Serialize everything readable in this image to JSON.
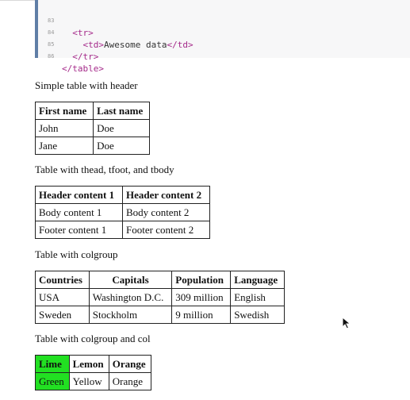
{
  "code": {
    "lines": [
      {
        "num": "83",
        "indent": "  ",
        "open": "<tr>",
        "text": "",
        "close": ""
      },
      {
        "num": "84",
        "indent": "    ",
        "open": "<td>",
        "text": "Awesome data",
        "close": "</td>"
      },
      {
        "num": "85",
        "indent": "  ",
        "open": "</tr>",
        "text": "",
        "close": ""
      },
      {
        "num": "86",
        "indent": "",
        "open": "</table>",
        "text": "",
        "close": ""
      }
    ]
  },
  "sections": {
    "simple": {
      "caption": "Simple table with header",
      "headers": [
        "First name",
        "Last name"
      ],
      "rows": [
        [
          "John",
          "Doe"
        ],
        [
          "Jane",
          "Doe"
        ]
      ]
    },
    "thead": {
      "caption": "Table with thead, tfoot, and tbody",
      "headers": [
        "Header content 1",
        "Header content 2"
      ],
      "rows": [
        [
          "Body content 1",
          "Body content 2"
        ],
        [
          "Footer content 1",
          "Footer content 2"
        ]
      ]
    },
    "colgroup": {
      "caption": "Table with colgroup",
      "headers": [
        "Countries",
        "Capitals",
        "Population",
        "Language"
      ],
      "rows": [
        [
          "USA",
          "Washington D.C.",
          "309 million",
          "English"
        ],
        [
          "Sweden",
          "Stockholm",
          "9 million",
          "Swedish"
        ]
      ]
    },
    "colgroup_col": {
      "caption": "Table with colgroup and col",
      "headers": [
        "Lime",
        "Lemon",
        "Orange"
      ],
      "rows": [
        [
          "Green",
          "Yellow",
          "Orange"
        ]
      ],
      "highlight_color": "#22e022"
    }
  }
}
